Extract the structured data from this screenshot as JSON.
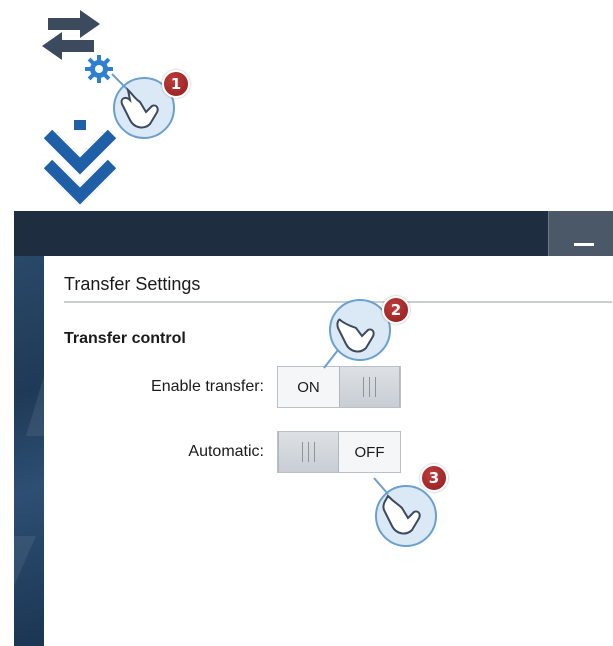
{
  "steps": {
    "step1_number": "1",
    "step2_number": "2",
    "step3_number": "3"
  },
  "window": {
    "minimize_label": ""
  },
  "panel": {
    "title": "Transfer Settings",
    "section_title": "Transfer control",
    "enable_transfer": {
      "label": "Enable transfer:",
      "state": "ON"
    },
    "automatic": {
      "label": "Automatic:",
      "state": "OFF"
    }
  },
  "colors": {
    "titlebar": "#1e2d3f",
    "accent_blue": "#1f5fa8",
    "badge_red": "#a52a2a"
  },
  "icons": [
    "transfer-arrows-icon",
    "gear-icon",
    "tap-hand-icon",
    "double-chevron-down-icon"
  ]
}
